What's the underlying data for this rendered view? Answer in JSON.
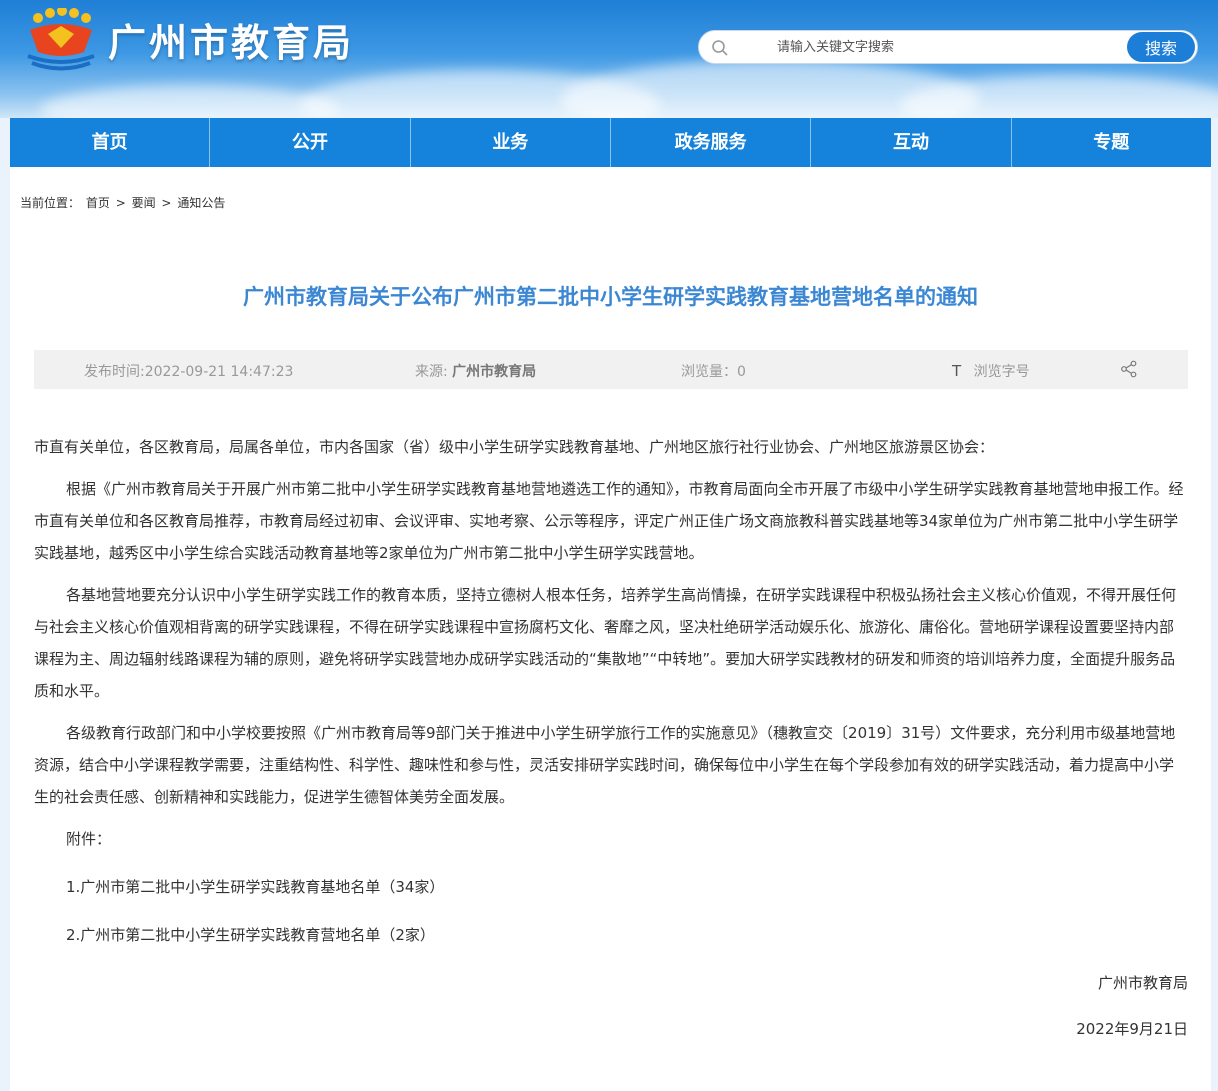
{
  "header": {
    "site_title": "广州市教育局",
    "search_placeholder": "请输入关键文字搜索",
    "search_button": "搜索"
  },
  "nav": {
    "items": [
      "首页",
      "公开",
      "业务",
      "政务服务",
      "互动",
      "专题"
    ]
  },
  "breadcrumb": {
    "label": "当前位置：",
    "items": [
      "首页",
      "要闻",
      "通知公告"
    ],
    "separator": ">"
  },
  "article": {
    "title": "广州市教育局关于公布广州市第二批中小学生研学实践教育基地营地名单的通知",
    "meta": {
      "publish_time": "发布时间:2022-09-21 14:47:23",
      "source_label": "来源:",
      "source_value": "广州市教育局",
      "views": "浏览量：0",
      "font_icon": "T",
      "font_label": "浏览字号"
    },
    "salutation": "市直有关单位，各区教育局，局属各单位，市内各国家（省）级中小学生研学实践教育基地、广州地区旅行社行业协会、广州地区旅游景区协会：",
    "paragraphs": [
      "根据《广州市教育局关于开展广州市第二批中小学生研学实践教育基地营地遴选工作的通知》，市教育局面向全市开展了市级中小学生研学实践教育基地营地申报工作。经市直有关单位和各区教育局推荐，市教育局经过初审、会议评审、实地考察、公示等程序，评定广州正佳广场文商旅教科普实践基地等34家单位为广州市第二批中小学生研学实践基地，越秀区中小学生综合实践活动教育基地等2家单位为广州市第二批中小学生研学实践营地。",
      "各基地营地要充分认识中小学生研学实践工作的教育本质，坚持立德树人根本任务，培养学生高尚情操，在研学实践课程中积极弘扬社会主义核心价值观，不得开展任何与社会主义核心价值观相背离的研学实践课程，不得在研学实践课程中宣扬腐朽文化、奢靡之风，坚决杜绝研学活动娱乐化、旅游化、庸俗化。营地研学课程设置要坚持内部课程为主、周边辐射线路课程为辅的原则，避免将研学实践营地办成研学实践活动的“集散地”“中转地”。要加大研学实践教材的研发和师资的培训培养力度，全面提升服务品质和水平。",
      "各级教育行政部门和中小学校要按照《广州市教育局等9部门关于推进中小学生研学旅行工作的实施意见》（穗教宣交〔2019〕31号）文件要求，充分利用市级基地营地资源，结合中小学课程教学需要，注重结构性、科学性、趣味性和参与性，灵活安排研学实践时间，确保每位中小学生在每个学段参加有效的研学实践活动，着力提高中小学生的社会责任感、创新精神和实践能力，促进学生德智体美劳全面发展。"
    ],
    "attachments_label": "附件：",
    "attachments": [
      "1.广州市第二批中小学生研学实践教育基地名单（34家）",
      "2.广州市第二批中小学生研学实践教育营地名单（2家）"
    ],
    "signature": "广州市教育局",
    "date": "2022年9月21日"
  },
  "colors": {
    "nav_bg": "#1583dc",
    "title": "#3b87d3",
    "search_button": "#1d7ed8"
  }
}
